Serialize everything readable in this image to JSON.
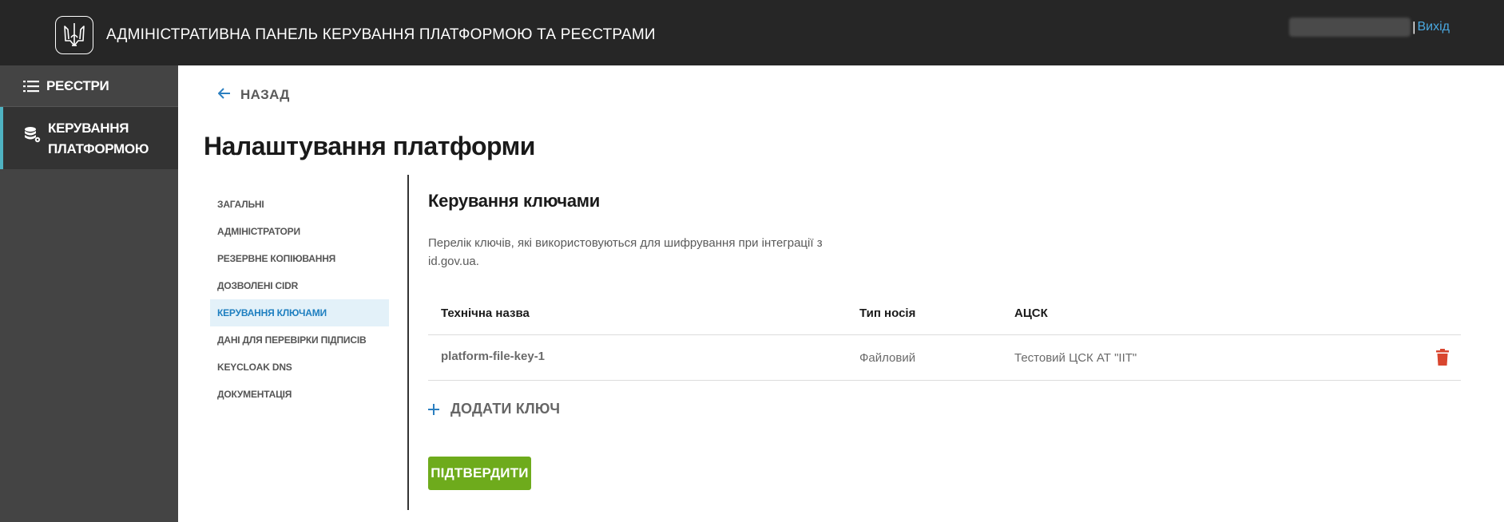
{
  "header": {
    "title": "АДМІНІСТРАТИВНА ПАНЕЛЬ КЕРУВАННЯ ПЛАТФОРМОЮ ТА РЕЄСТРАМИ",
    "separator": "|",
    "logout_label": "Вихід",
    "logo_icon": "trident-icon"
  },
  "sidebar": {
    "items": [
      {
        "label": "РЕЄСТРИ",
        "icon": "list-icon",
        "active": false
      },
      {
        "label_line1": "КЕРУВАННЯ",
        "label_line2": "ПЛАТФОРМОЮ",
        "icon": "database-gear-icon",
        "active": true
      }
    ]
  },
  "main": {
    "back_label": "НАЗАД",
    "page_title": "Налаштування платформи",
    "settings_nav": [
      "ЗАГАЛЬНІ",
      "АДМІНІСТРАТОРИ",
      "РЕЗЕРВНЕ КОПІЮВАННЯ",
      "ДОЗВОЛЕНІ CIDR",
      "КЕРУВАННЯ КЛЮЧАМИ",
      "ДАНІ ДЛЯ ПЕРЕВІРКИ ПІДПИСІВ",
      "KEYCLOAK DNS",
      "ДОКУМЕНТАЦІЯ"
    ],
    "active_nav": "КЕРУВАННЯ КЛЮЧАМИ",
    "section": {
      "title": "Керування ключами",
      "description": "Перелік ключів, які використовуються для шифрування при інтеграції з id.gov.ua.",
      "table": {
        "columns": [
          "Технічна назва",
          "Тип носія",
          "АЦСК"
        ],
        "rows": [
          {
            "name": "platform-file-key-1",
            "media_type": "Файловий",
            "acsk": "Тестовий ЦСК АТ \"ІІТ\""
          }
        ]
      },
      "add_key_label": "ДОДАТИ КЛЮЧ",
      "confirm_label": "ПІДТВЕРДИТИ"
    }
  },
  "colors": {
    "header_bg": "#262626",
    "sidebar_bg": "#444444",
    "sidebar_active_bg": "#333333",
    "sidebar_active_border": "#4fb3c2",
    "link_blue": "#2b7fc0",
    "nav_active_bg": "#e3f1f9",
    "confirm_green": "#6eab1c",
    "delete_red": "#d9462f"
  }
}
